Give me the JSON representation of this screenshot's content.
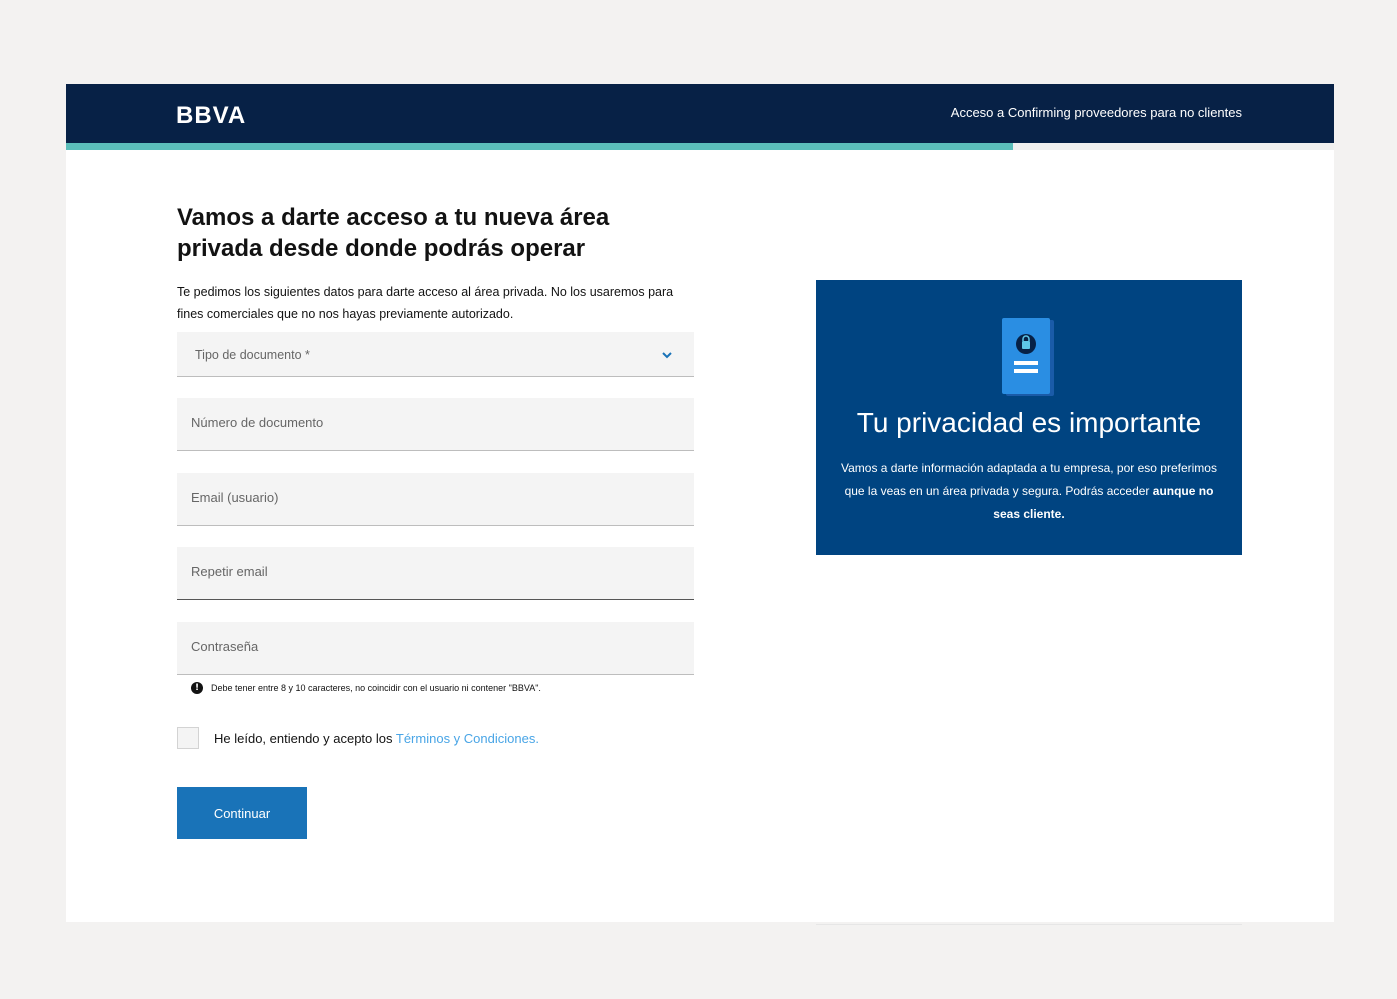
{
  "header": {
    "logo": "BBVA",
    "link": "Acceso a Confirming proveedores para no clientes",
    "progress_fraction": 0.747
  },
  "form": {
    "title": "Vamos a darte acceso a tu nueva área privada desde donde podrás operar",
    "intro": "Te pedimos los siguientes datos para darte acceso al área privada. No los usaremos para fines comerciales que no nos hayas previamente autorizado.",
    "fields": {
      "document_type": "Tipo de documento *",
      "document_number": "Número de documento",
      "email": "Email (usuario)",
      "repeat_email": "Repetir email",
      "password": "Contraseña"
    },
    "password_hint": "Debe tener entre 8 y 10 caracteres, no coincidir con el usuario ni contener \"BBVA\".",
    "terms_text": "He leído, entiendo y acepto los ",
    "terms_link": "Términos y Condiciones.",
    "submit": "Continuar"
  },
  "promo": {
    "icon": "locked-document-icon",
    "title": "Tu privacidad es importante",
    "text": "Vamos a darte información adaptada a tu empresa, por eso preferimos que la veas en un área privada y segura. Podrás acceder ",
    "text_bold": "aunque no seas cliente."
  },
  "colors": {
    "navy": "#072146",
    "teal": "#5bbeba",
    "blue_button": "#1973b8",
    "promo_blue": "#004481",
    "link_blue": "#49a5e6"
  }
}
